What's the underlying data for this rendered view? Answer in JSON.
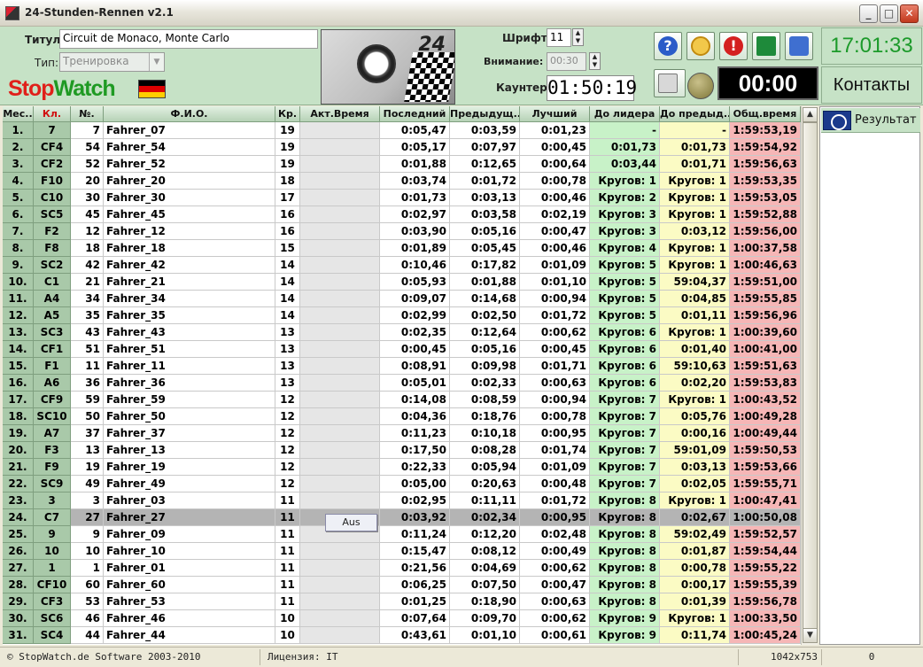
{
  "window": {
    "title": "24-Stunden-Rennen v2.1"
  },
  "header": {
    "title_label": "Титул:",
    "title_value": "Circuit de Monaco, Monte Carlo",
    "type_label": "Тип:",
    "type_value": "Тренировка",
    "font_label": "Шрифт:",
    "font_value": "11",
    "attention_label": "Внимание:",
    "attention_value": "00:30",
    "counter_label": "Каунтер:",
    "counter_value": "01:50:19",
    "logo_part1": "Stop",
    "logo_part2": "Watch",
    "banner_text": "24",
    "clock": "17:01:33",
    "timer": "00:00",
    "contacts_label": "Контакты"
  },
  "toolbar": {
    "help_glyph": "?",
    "alarm_glyph": "!"
  },
  "flag_colors": [
    "#000000",
    "#dd0000",
    "#ffce00"
  ],
  "table": {
    "columns": [
      "Мес..",
      "Кл.",
      "№.",
      "Ф.И.О.",
      "Кр.",
      "Акт.Время",
      "Последний",
      "Предыдущ..",
      "Лучший",
      "До лидера",
      "До предыд..",
      "Общ.время"
    ],
    "rows": [
      [
        "1.",
        "7",
        "7",
        "Fahrer_07",
        "19",
        "",
        "0:05,47",
        "0:03,59",
        "0:01,23",
        "-",
        "-",
        "1:59:53,19"
      ],
      [
        "2.",
        "CF4",
        "54",
        "Fahrer_54",
        "19",
        "",
        "0:05,17",
        "0:07,97",
        "0:00,45",
        "0:01,73",
        "0:01,73",
        "1:59:54,92"
      ],
      [
        "3.",
        "CF2",
        "52",
        "Fahrer_52",
        "19",
        "",
        "0:01,88",
        "0:12,65",
        "0:00,64",
        "0:03,44",
        "0:01,71",
        "1:59:56,63"
      ],
      [
        "4.",
        "F10",
        "20",
        "Fahrer_20",
        "18",
        "",
        "0:03,74",
        "0:01,72",
        "0:00,78",
        "Кругов: 1",
        "Кругов: 1",
        "1:59:53,35"
      ],
      [
        "5.",
        "C10",
        "30",
        "Fahrer_30",
        "17",
        "",
        "0:01,73",
        "0:03,13",
        "0:00,46",
        "Кругов: 2",
        "Кругов: 1",
        "1:59:53,05"
      ],
      [
        "6.",
        "SC5",
        "45",
        "Fahrer_45",
        "16",
        "",
        "0:02,97",
        "0:03,58",
        "0:02,19",
        "Кругов: 3",
        "Кругов: 1",
        "1:59:52,88"
      ],
      [
        "7.",
        "F2",
        "12",
        "Fahrer_12",
        "16",
        "",
        "0:03,90",
        "0:05,16",
        "0:00,47",
        "Кругов: 3",
        "0:03,12",
        "1:59:56,00"
      ],
      [
        "8.",
        "F8",
        "18",
        "Fahrer_18",
        "15",
        "",
        "0:01,89",
        "0:05,45",
        "0:00,46",
        "Кругов: 4",
        "Кругов: 1",
        "1:00:37,58"
      ],
      [
        "9.",
        "SC2",
        "42",
        "Fahrer_42",
        "14",
        "",
        "0:10,46",
        "0:17,82",
        "0:01,09",
        "Кругов: 5",
        "Кругов: 1",
        "1:00:46,63"
      ],
      [
        "10.",
        "C1",
        "21",
        "Fahrer_21",
        "14",
        "",
        "0:05,93",
        "0:01,88",
        "0:01,10",
        "Кругов: 5",
        "59:04,37",
        "1:59:51,00"
      ],
      [
        "11.",
        "A4",
        "34",
        "Fahrer_34",
        "14",
        "",
        "0:09,07",
        "0:14,68",
        "0:00,94",
        "Кругов: 5",
        "0:04,85",
        "1:59:55,85"
      ],
      [
        "12.",
        "A5",
        "35",
        "Fahrer_35",
        "14",
        "",
        "0:02,99",
        "0:02,50",
        "0:01,72",
        "Кругов: 5",
        "0:01,11",
        "1:59:56,96"
      ],
      [
        "13.",
        "SC3",
        "43",
        "Fahrer_43",
        "13",
        "",
        "0:02,35",
        "0:12,64",
        "0:00,62",
        "Кругов: 6",
        "Кругов: 1",
        "1:00:39,60"
      ],
      [
        "14.",
        "CF1",
        "51",
        "Fahrer_51",
        "13",
        "",
        "0:00,45",
        "0:05,16",
        "0:00,45",
        "Кругов: 6",
        "0:01,40",
        "1:00:41,00"
      ],
      [
        "15.",
        "F1",
        "11",
        "Fahrer_11",
        "13",
        "",
        "0:08,91",
        "0:09,98",
        "0:01,71",
        "Кругов: 6",
        "59:10,63",
        "1:59:51,63"
      ],
      [
        "16.",
        "A6",
        "36",
        "Fahrer_36",
        "13",
        "",
        "0:05,01",
        "0:02,33",
        "0:00,63",
        "Кругов: 6",
        "0:02,20",
        "1:59:53,83"
      ],
      [
        "17.",
        "CF9",
        "59",
        "Fahrer_59",
        "12",
        "",
        "0:14,08",
        "0:08,59",
        "0:00,94",
        "Кругов: 7",
        "Кругов: 1",
        "1:00:43,52"
      ],
      [
        "18.",
        "SC10",
        "50",
        "Fahrer_50",
        "12",
        "",
        "0:04,36",
        "0:18,76",
        "0:00,78",
        "Кругов: 7",
        "0:05,76",
        "1:00:49,28"
      ],
      [
        "19.",
        "A7",
        "37",
        "Fahrer_37",
        "12",
        "",
        "0:11,23",
        "0:10,18",
        "0:00,95",
        "Кругов: 7",
        "0:00,16",
        "1:00:49,44"
      ],
      [
        "20.",
        "F3",
        "13",
        "Fahrer_13",
        "12",
        "",
        "0:17,50",
        "0:08,28",
        "0:01,74",
        "Кругов: 7",
        "59:01,09",
        "1:59:50,53"
      ],
      [
        "21.",
        "F9",
        "19",
        "Fahrer_19",
        "12",
        "",
        "0:22,33",
        "0:05,94",
        "0:01,09",
        "Кругов: 7",
        "0:03,13",
        "1:59:53,66"
      ],
      [
        "22.",
        "SC9",
        "49",
        "Fahrer_49",
        "12",
        "",
        "0:05,00",
        "0:20,63",
        "0:00,48",
        "Кругов: 7",
        "0:02,05",
        "1:59:55,71"
      ],
      [
        "23.",
        "3",
        "3",
        "Fahrer_03",
        "11",
        "",
        "0:02,95",
        "0:11,11",
        "0:01,72",
        "Кругов: 8",
        "Кругов: 1",
        "1:00:47,41"
      ],
      [
        "24.",
        "C7",
        "27",
        "Fahrer_27",
        "11",
        "",
        "0:03,92",
        "0:02,34",
        "0:00,95",
        "Кругов: 8",
        "0:02,67",
        "1:00:50,08"
      ],
      [
        "25.",
        "9",
        "9",
        "Fahrer_09",
        "11",
        "",
        "0:11,24",
        "0:12,20",
        "0:02,48",
        "Кругов: 8",
        "59:02,49",
        "1:59:52,57"
      ],
      [
        "26.",
        "10",
        "10",
        "Fahrer_10",
        "11",
        "",
        "0:15,47",
        "0:08,12",
        "0:00,49",
        "Кругов: 8",
        "0:01,87",
        "1:59:54,44"
      ],
      [
        "27.",
        "1",
        "1",
        "Fahrer_01",
        "11",
        "",
        "0:21,56",
        "0:04,69",
        "0:00,62",
        "Кругов: 8",
        "0:00,78",
        "1:59:55,22"
      ],
      [
        "28.",
        "CF10",
        "60",
        "Fahrer_60",
        "11",
        "",
        "0:06,25",
        "0:07,50",
        "0:00,47",
        "Кругов: 8",
        "0:00,17",
        "1:59:55,39"
      ],
      [
        "29.",
        "CF3",
        "53",
        "Fahrer_53",
        "11",
        "",
        "0:01,25",
        "0:18,90",
        "0:00,63",
        "Кругов: 8",
        "0:01,39",
        "1:59:56,78"
      ],
      [
        "30.",
        "SC6",
        "46",
        "Fahrer_46",
        "10",
        "",
        "0:07,64",
        "0:09,70",
        "0:00,62",
        "Кругов: 9",
        "Кругов: 1",
        "1:00:33,50"
      ],
      [
        "31.",
        "SC4",
        "44",
        "Fahrer_44",
        "10",
        "",
        "0:43,61",
        "0:01,10",
        "0:00,61",
        "Кругов: 9",
        "0:11,74",
        "1:00:45,24"
      ]
    ],
    "selected_row": 23,
    "popup_label": "Aus"
  },
  "side_panel": {
    "result_label": "Результат"
  },
  "status_bar": {
    "copyright": "© StopWatch.de Software 2003-2010",
    "license": "Лицензия: IT",
    "resolution": "1042x753",
    "count": "0"
  }
}
